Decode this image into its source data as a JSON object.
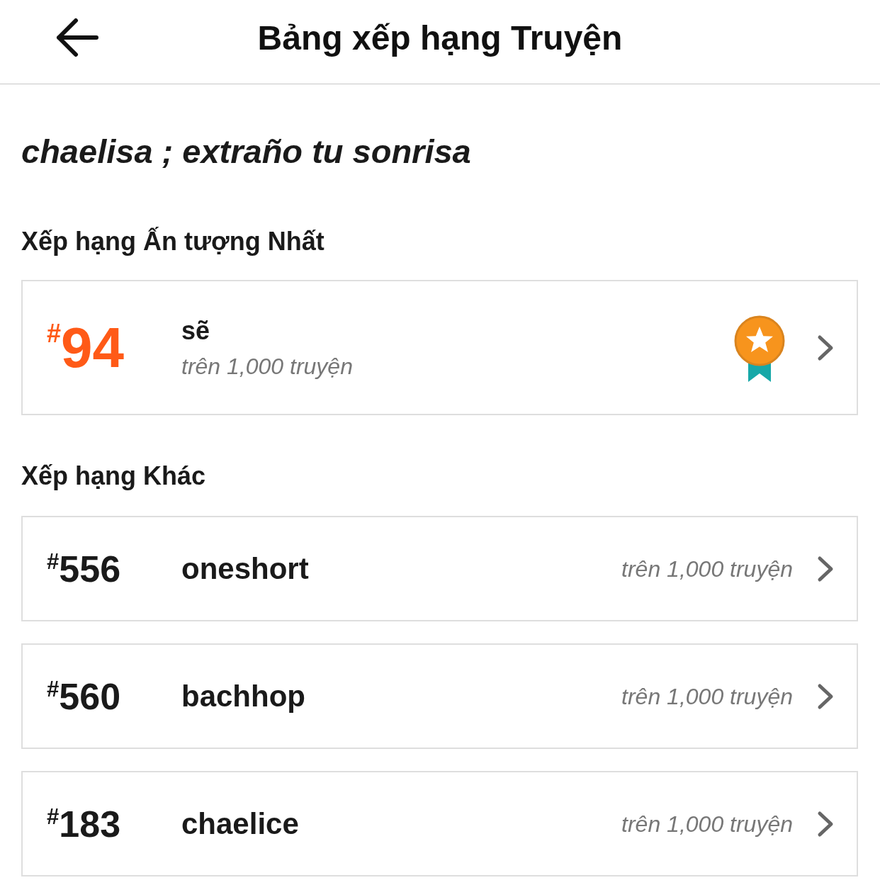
{
  "header": {
    "title": "Bảng xếp hạng Truyện"
  },
  "story_title": "chaelisa ; extraño tu sonrisa",
  "top_section": {
    "heading": "Xếp hạng Ấn tượng Nhất",
    "ranking": {
      "rank": "$^{#}$94",
      "tag": "sẽ",
      "subtitle": "trên 1,000 truyện"
    }
  },
  "other_section": {
    "heading": "Xếp hạng Khác",
    "rankings": [
      {
        "rank": "$^{#}$556",
        "tag": "oneshort",
        "subtitle": "trên 1,000 truyện"
      },
      {
        "rank": "$^{#}$560",
        "tag": "bachhop",
        "subtitle": "trên 1,000 truyện"
      },
      {
        "rank": "$^{#}$183",
        "tag": "chaelice",
        "subtitle": "trên 1,000 truyện"
      }
    ]
  }
}
